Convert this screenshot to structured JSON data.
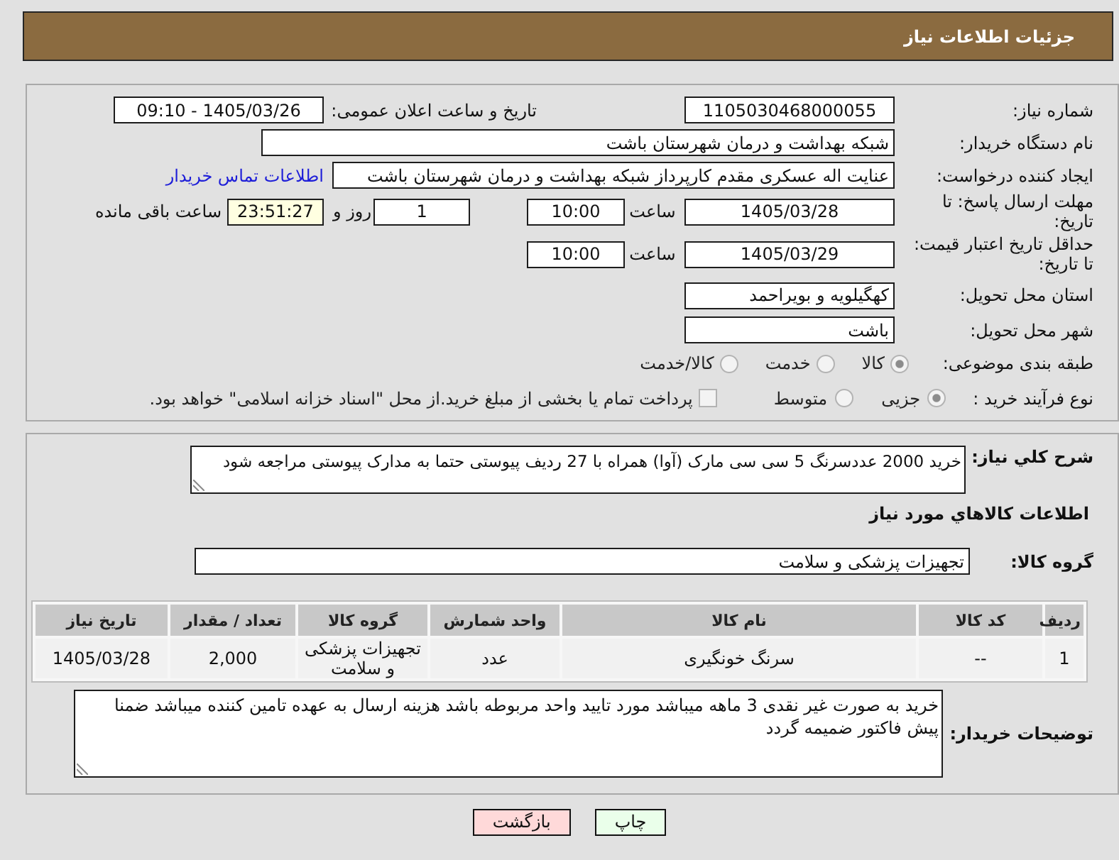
{
  "header": {
    "title": "جزئیات اطلاعات نیاز"
  },
  "details": {
    "need_number": {
      "label": "شماره نیاز:",
      "value": "1105030468000055"
    },
    "announcement": {
      "label": "تاریخ و ساعت اعلان عمومی:",
      "value": "1405/03/26 - 09:10"
    },
    "buyer_org": {
      "label": "نام دستگاه خریدار:",
      "value": "شبکه بهداشت و درمان شهرستان باشت"
    },
    "requester": {
      "label": "ایجاد کننده درخواست:",
      "value": "عنایت اله عسکری مقدم کارپرداز شبکه بهداشت و درمان شهرستان باشت",
      "link": "اطلاعات تماس خریدار"
    },
    "response_deadline": {
      "label": "مهلت ارسال پاسخ: تا تاریخ:",
      "date": "1405/03/28",
      "time_label": "ساعت",
      "time": "10:00",
      "days": "1",
      "days_label": "روز و",
      "remaining": "23:51:27",
      "remaining_label": "ساعت باقی مانده"
    },
    "price_validity": {
      "label": "حداقل تاریخ اعتبار قیمت: تا تاریخ:",
      "date": "1405/03/29",
      "time_label": "ساعت",
      "time": "10:00"
    },
    "delivery_province": {
      "label": "استان محل تحویل:",
      "value": "کهگیلویه و بویراحمد"
    },
    "delivery_city": {
      "label": "شهر محل تحویل:",
      "value": "باشت"
    },
    "classification": {
      "label": "طبقه بندی موضوعی:",
      "options": [
        {
          "label": "کالا",
          "selected": true
        },
        {
          "label": "خدمت",
          "selected": false
        },
        {
          "label": "کالا/خدمت",
          "selected": false
        }
      ]
    },
    "purchase_process": {
      "label": "نوع فرآیند خرید :",
      "options": [
        {
          "label": "جزیی",
          "selected": true
        },
        {
          "label": "متوسط",
          "selected": false
        }
      ],
      "treasury": {
        "label": "پرداخت تمام یا بخشی از مبلغ خرید.از محل \"اسناد خزانه اسلامی\" خواهد بود.",
        "checked": false
      }
    }
  },
  "summary": {
    "label": "شرح کلي نیاز:",
    "value": "خرید 2000 عددسرنگ 5 سی سی مارک (آوا) همراه با 27 ردیف پیوستی حتما به مدارک پیوستی مراجعه شود"
  },
  "goods": {
    "title": "اطلاعات کالاهاي مورد نیاز",
    "group_label": "گروه کالا:",
    "group": "تجهیزات پزشکی و سلامت",
    "table": {
      "columns": [
        "ردیف",
        "کد کالا",
        "نام کالا",
        "واحد شمارش",
        "گروه کالا",
        "تعداد / مقدار",
        "تاریخ نیاز"
      ],
      "rows": [
        [
          "1",
          "--",
          "سرنگ خونگیری",
          "عدد",
          "تجهیزات پزشکی و سلامت",
          "2,000",
          "1405/03/28"
        ]
      ]
    }
  },
  "buyer_notes": {
    "label": "توضیحات خریدار:",
    "value": "خرید به صورت غیر نقدی 3 ماهه میباشد مورد تایید واحد مربوطه باشد هزینه ارسال به عهده تامین کننده میباشد ضمنا پیش فاکتور ضمیمه گردد"
  },
  "buttons": [
    {
      "label": "چاپ",
      "kind": "print"
    },
    {
      "label": "بازگشت",
      "kind": "back"
    }
  ]
}
